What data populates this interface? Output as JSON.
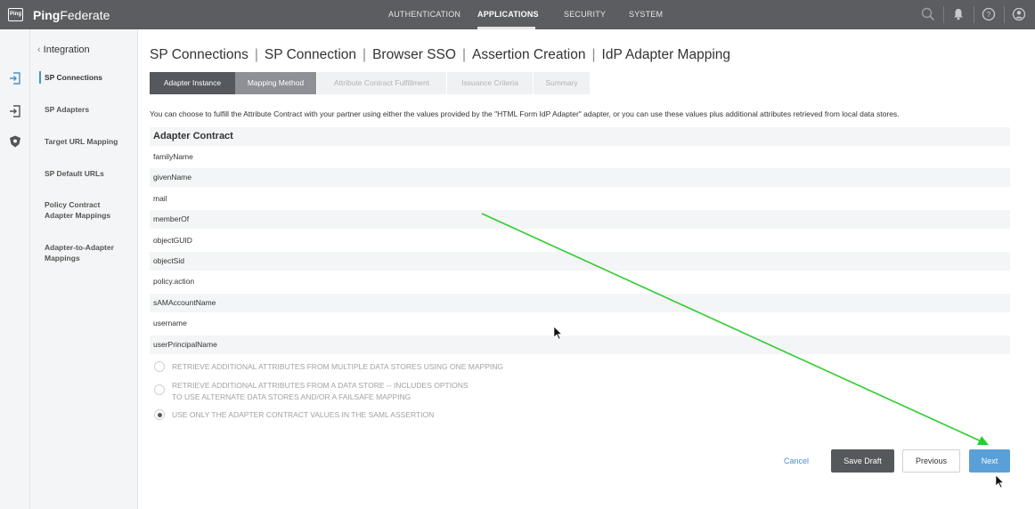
{
  "header": {
    "logo_text": "Ping",
    "brand_bold": "Ping",
    "brand_rest": "Federate",
    "nav": [
      "AUTHENTICATION",
      "APPLICATIONS",
      "SECURITY",
      "SYSTEM"
    ],
    "active_nav": "APPLICATIONS",
    "icons": [
      "search-icon",
      "bell-icon",
      "help-icon",
      "user-icon"
    ]
  },
  "rail": {
    "icons": [
      "sign-in-icon",
      "sign-in-alt-icon",
      "shield-icon"
    ]
  },
  "leftnav": {
    "back_label": "Integration",
    "items": [
      "SP Connections",
      "SP Adapters",
      "Target URL Mapping",
      "SP Default URLs",
      "Policy Contract\nAdapter Mappings",
      "Adapter-to-Adapter\nMappings"
    ],
    "active_index": 0
  },
  "breadcrumb": [
    "SP Connections",
    "SP Connection",
    "Browser SSO",
    "Assertion Creation",
    "IdP Adapter Mapping"
  ],
  "tabs": [
    {
      "label": "Adapter Instance",
      "state": "done"
    },
    {
      "label": "Mapping Method",
      "state": "current"
    },
    {
      "label": "Attribute Contract Fulfillment",
      "state": "future"
    },
    {
      "label": "Issuance Criteria",
      "state": "future"
    },
    {
      "label": "Summary",
      "state": "future"
    }
  ],
  "description": "You can choose to fulfill the Attribute Contract with your partner using either the values provided by the \"HTML Form IdP Adapter\" adapter, or you can use these values plus additional attributes retrieved from local data stores.",
  "contract": {
    "heading": "Adapter Contract",
    "attributes": [
      "familyName",
      "givenName",
      "mail",
      "memberOf",
      "objectGUID",
      "objectSid",
      "policy.action",
      "sAMAccountName",
      "username",
      "userPrincipalName"
    ]
  },
  "options": [
    {
      "lines": [
        "RETRIEVE ADDITIONAL ATTRIBUTES FROM MULTIPLE DATA STORES USING ONE MAPPING"
      ],
      "checked": false
    },
    {
      "lines": [
        "RETRIEVE ADDITIONAL ATTRIBUTES FROM A DATA STORE -- INCLUDES OPTIONS",
        "TO USE ALTERNATE DATA STORES AND/OR A FAILSAFE MAPPING"
      ],
      "checked": false
    },
    {
      "lines": [
        "USE ONLY THE ADAPTER CONTRACT VALUES IN THE SAML ASSERTION"
      ],
      "checked": true
    }
  ],
  "buttons": {
    "cancel": "Cancel",
    "save_draft": "Save Draft",
    "previous": "Previous",
    "next": "Next"
  },
  "colors": {
    "topbar": "#5b5d60",
    "accent": "#5aa0d8",
    "annotation": "#2ecc2e"
  }
}
